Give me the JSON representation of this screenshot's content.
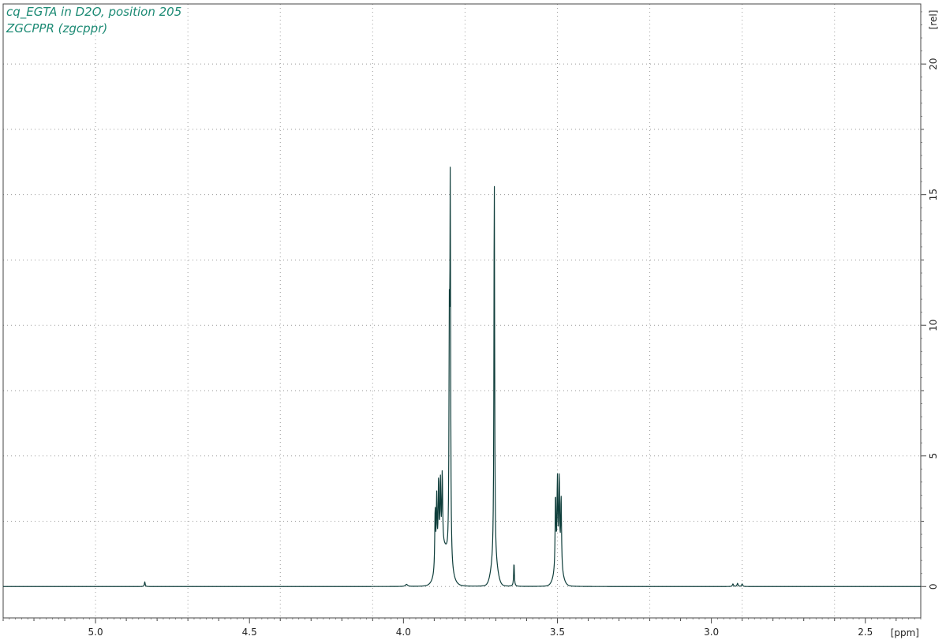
{
  "chart_data": {
    "type": "line",
    "title_lines": [
      "cq_EGTA in D2O, position 205",
      "ZGCPPR (zgcppr)"
    ],
    "xlabel": "[ppm]",
    "ylabel": "[rel]",
    "xlim": [
      5.3,
      2.32
    ],
    "ylim": [
      -1.2,
      22.3
    ],
    "x_reversed": true,
    "x_ticks": [
      5.0,
      4.5,
      4.0,
      3.5,
      3.0,
      2.5
    ],
    "x_tick_labels": [
      "5.0",
      "4.5",
      "4.0",
      "3.5",
      "3.0",
      "2.5"
    ],
    "y_ticks": [
      0,
      5,
      10,
      15,
      20
    ],
    "y_tick_labels": [
      "0",
      "5",
      "10",
      "15",
      "20"
    ],
    "grid": true,
    "line_color": "#0e3d3a",
    "title_color": "#1c8a74",
    "series": [
      {
        "peaks": [
          {
            "ppm": 4.84,
            "height": 0.18,
            "width": 0.0015
          },
          {
            "ppm": 3.99,
            "height": 0.08,
            "width": 0.004
          },
          {
            "ppm": 3.897,
            "height": 2.3,
            "width": 0.0016
          },
          {
            "ppm": 3.892,
            "height": 2.5,
            "width": 0.0016
          },
          {
            "ppm": 3.886,
            "height": 2.9,
            "width": 0.0016
          },
          {
            "ppm": 3.88,
            "height": 2.6,
            "width": 0.0016
          },
          {
            "ppm": 3.874,
            "height": 2.8,
            "width": 0.0016
          },
          {
            "ppm": 3.851,
            "height": 8.0,
            "width": 0.0014
          },
          {
            "ppm": 3.848,
            "height": 14.0,
            "width": 0.0014
          },
          {
            "ppm": 3.705,
            "height": 14.8,
            "width": 0.0014
          },
          {
            "ppm": 3.641,
            "height": 0.9,
            "width": 0.0014
          },
          {
            "ppm": 3.506,
            "height": 2.8,
            "width": 0.0016
          },
          {
            "ppm": 3.5,
            "height": 3.2,
            "width": 0.0016
          },
          {
            "ppm": 3.494,
            "height": 3.3,
            "width": 0.0016
          },
          {
            "ppm": 3.488,
            "height": 2.7,
            "width": 0.0016
          },
          {
            "ppm": 2.93,
            "height": 0.1,
            "width": 0.002
          },
          {
            "ppm": 2.915,
            "height": 0.12,
            "width": 0.002
          },
          {
            "ppm": 2.9,
            "height": 0.1,
            "width": 0.002
          }
        ],
        "humps": [
          {
            "ppm": 3.87,
            "height": 1.4,
            "width": 0.018
          },
          {
            "ppm": 3.705,
            "height": 0.9,
            "width": 0.01
          },
          {
            "ppm": 3.497,
            "height": 0.7,
            "width": 0.012
          }
        ]
      }
    ]
  }
}
